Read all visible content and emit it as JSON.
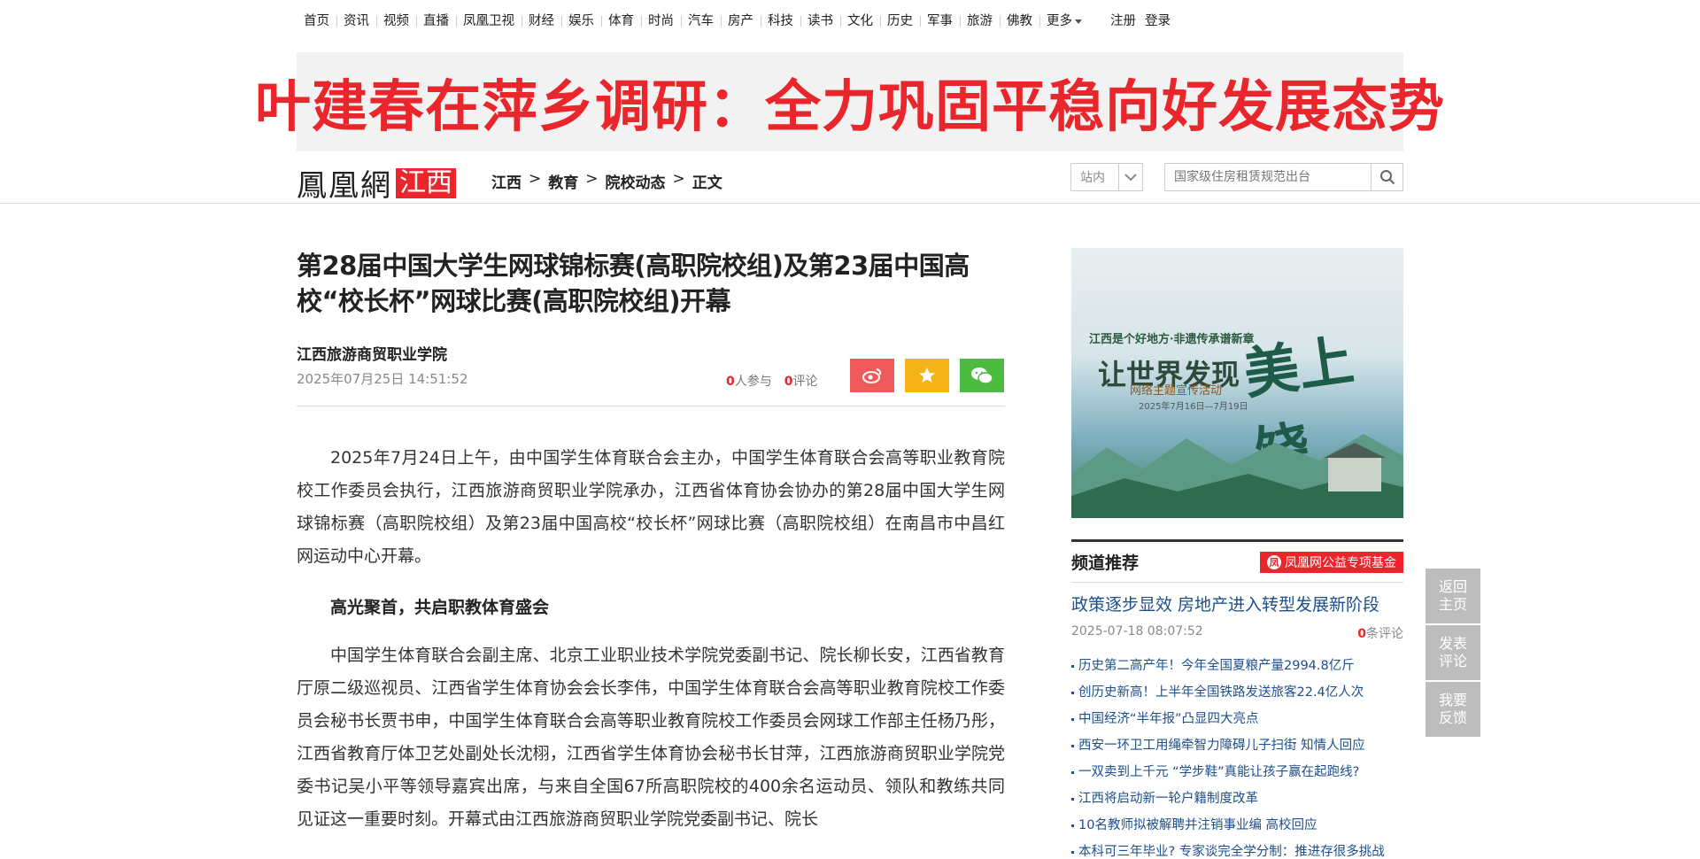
{
  "topnav": {
    "items": [
      "首页",
      "资讯",
      "视频",
      "直播",
      "凤凰卫视",
      "财经",
      "娱乐",
      "体育",
      "时尚",
      "汽车",
      "房产",
      "科技",
      "读书",
      "文化",
      "历史",
      "军事",
      "旅游",
      "佛教"
    ],
    "more": "更多",
    "register": "注册",
    "login": "登录"
  },
  "banner": {
    "headline": "叶建春在萍乡调研：全力巩固平稳向好发展态势"
  },
  "header": {
    "logo_text": "鳳凰網",
    "logo_region": "江西",
    "breadcrumb": [
      "江西",
      "教育",
      "院校动态",
      "正文"
    ],
    "site_select": "站内",
    "search_placeholder": "国家级住房租赁规范出台"
  },
  "article": {
    "title": "第28届中国大学生网球锦标赛(高职院校组)及第23届中国高校“校长杯”网球比赛(高职院校组)开幕",
    "source": "江西旅游商贸职业学院",
    "time": "2025年07月25日 14:51:52",
    "participants_count": "0",
    "participants_label": "人参与",
    "comments_count": "0",
    "comments_label": "评论",
    "para1": "2025年7月24日上午，由中国学生体育联合会主办，中国学生体育联合会高等职业教育院校工作委员会执行，江西旅游商贸职业学院承办，江西省体育协会协办的第28届中国大学生网球锦标赛（高职院校组）及第23届中国高校“校长杯”网球比赛（高职院校组）在南昌市中昌红网运动中心开幕。",
    "subhead": "高光聚首，共启职教体育盛会",
    "para2": "中国学生体育联合会副主席、北京工业职业技术学院党委副书记、院长柳长安，江西省教育厅原二级巡视员、江西省学生体育协会会长李伟，中国学生体育联合会高等职业教育院校工作委员会秘书长贾书申，中国学生体育联合会高等职业教育院校工作委员会网球工作部主任杨乃彤，江西省教育厅体卫艺处副处长沈栩，江西省学生体育协会秘书长甘萍，江西旅游商贸职业学院党委书记吴小平等领导嘉宾出席，与来自全国67所高职院校的400余名运动员、领队和教练共同见证这一重要时刻。开幕式由江西旅游商贸职业学院党委副书记、院长"
  },
  "sidebar": {
    "ad": {
      "tagline": "江西是个好地方·非遗传承谱新章",
      "headline": "让世界发现",
      "calligraphy": "美上饶",
      "subtitle": "网络主题宣传活动",
      "date": "2025年7月16日—7月19日"
    },
    "channel_title": "频道推荐",
    "fund_label": "凤凰网公益专项基金",
    "featured_title": "政策逐步显效 房地产进入转型发展新阶段",
    "featured_time": "2025-07-18 08:07:52",
    "featured_comments": "0",
    "featured_comments_label": "条评论",
    "list": [
      "历史第二高产年！今年全国夏粮产量2994.8亿斤",
      "创历史新高！上半年全国铁路发送旅客22.4亿人次",
      "中国经济“半年报”凸显四大亮点",
      "西安一环卫工用绳牵智力障碍儿子扫街 知情人回应",
      "一双卖到上千元 “学步鞋”真能让孩子赢在起跑线?",
      "江西将启动新一轮户籍制度改革",
      "10名教师拟被解聘并注销事业编 高校回应",
      "本科可三年毕业? 专家谈完全学分制：推进存很多挑战"
    ]
  },
  "floatbar": {
    "home": "返回主页",
    "comment": "发表评论",
    "feedback": "我要反馈"
  },
  "colors": {
    "brand_red": "#e8262b",
    "link_blue": "#1c4f8c",
    "weibo": "#f05a5b",
    "favorite": "#f4b417",
    "wechat": "#4cbb3f"
  }
}
